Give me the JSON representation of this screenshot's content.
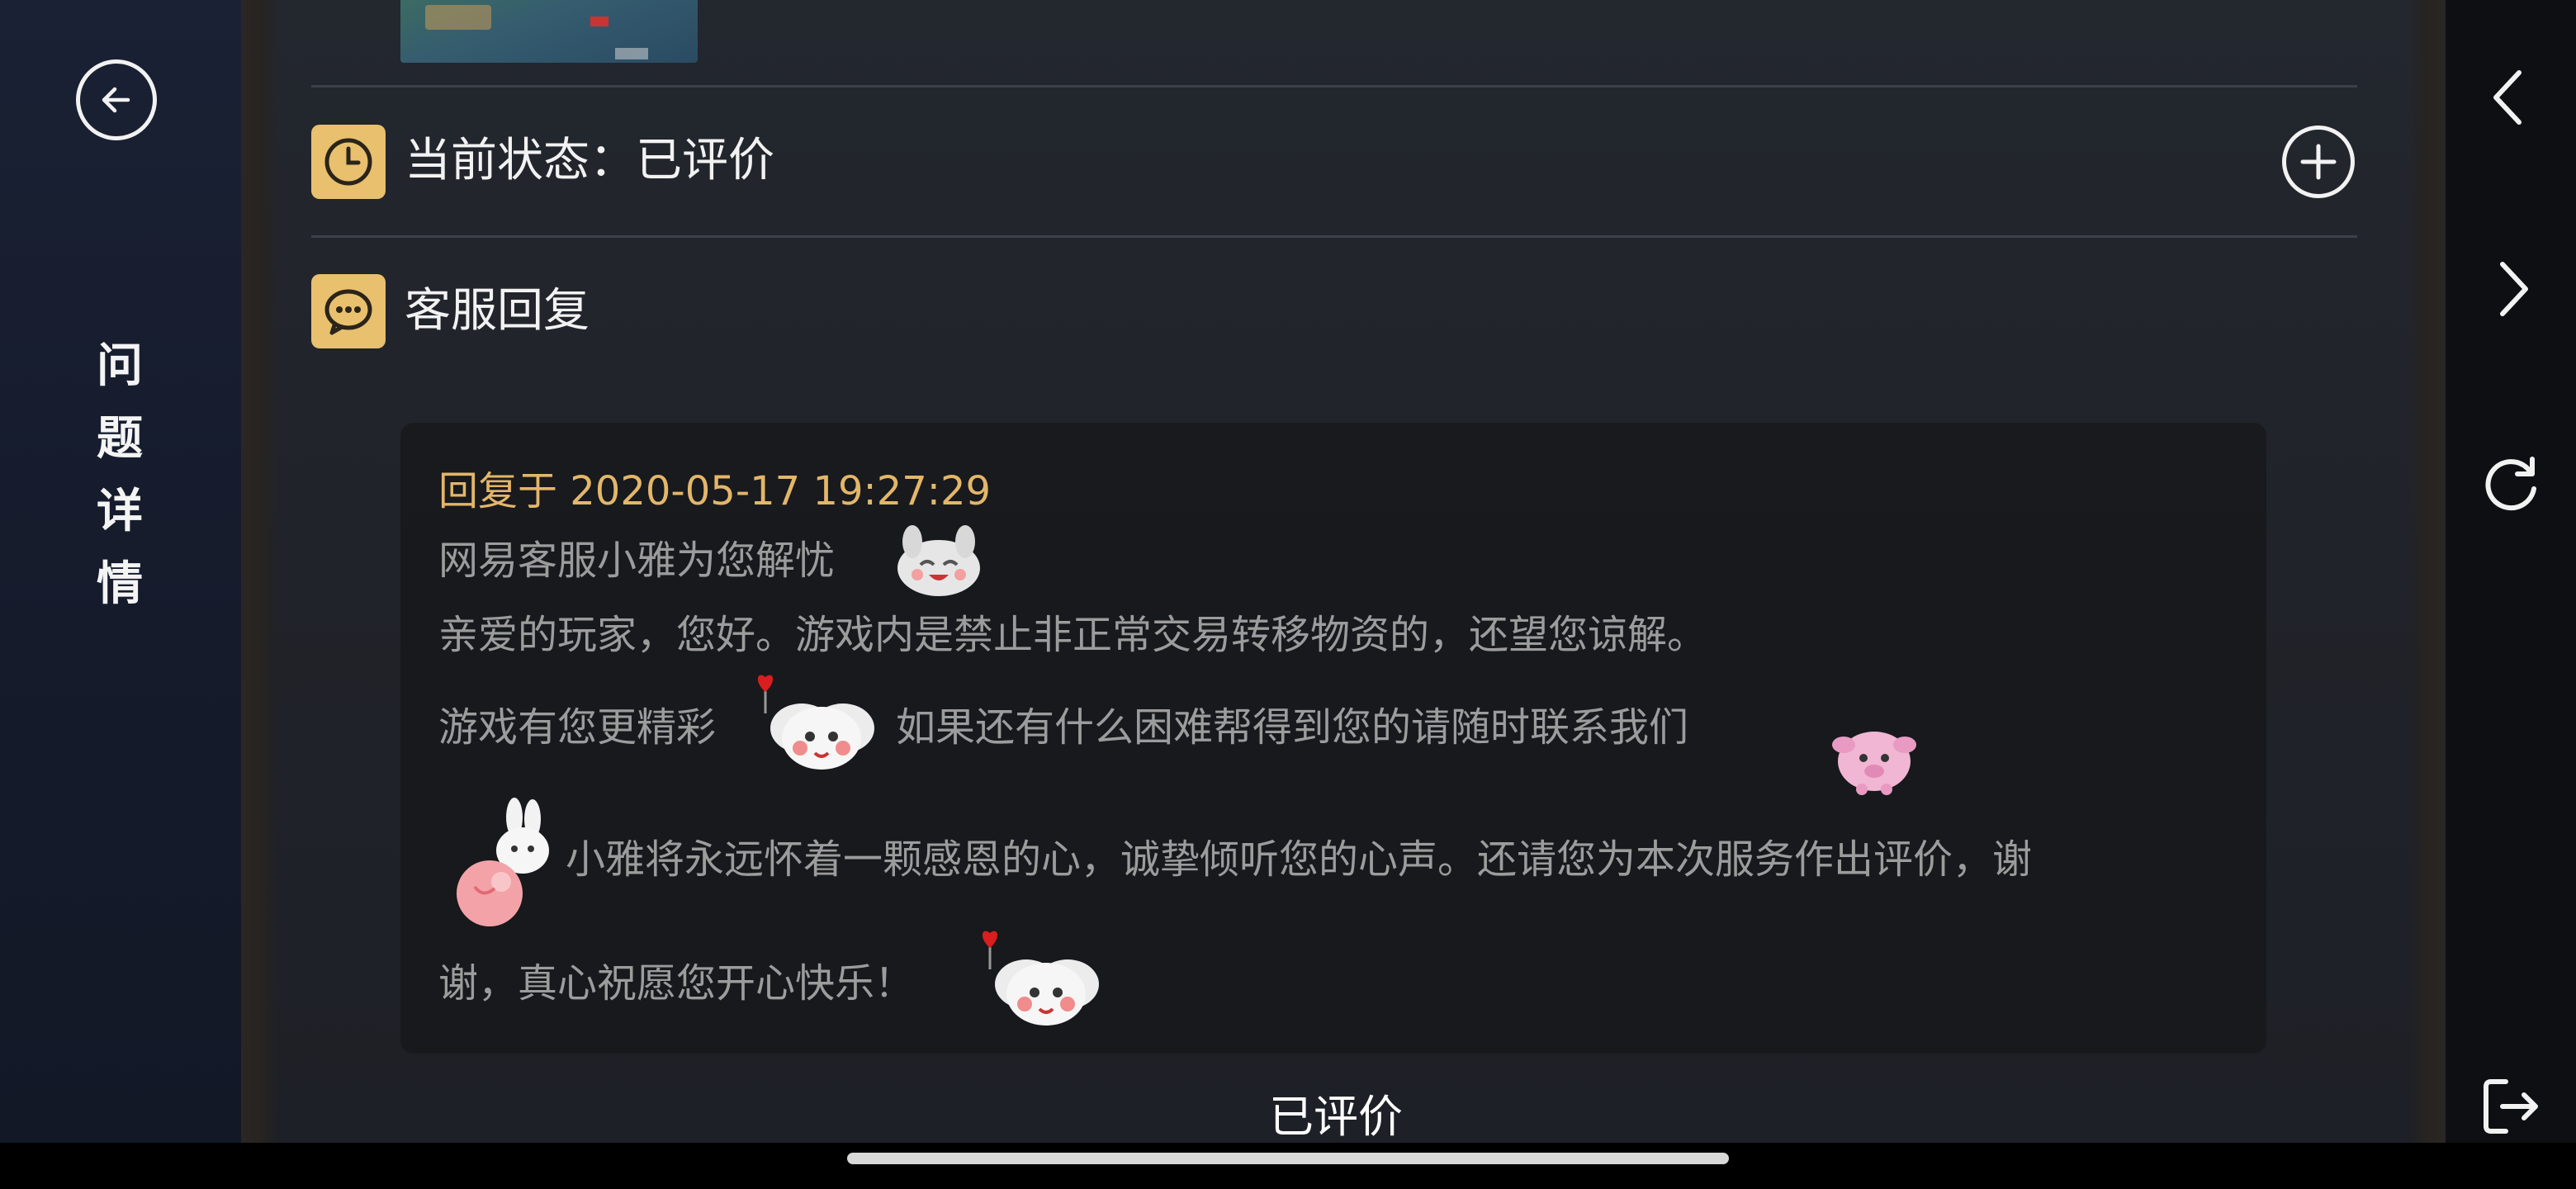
{
  "sidebar": {
    "title_chars": [
      "问",
      "题",
      "详",
      "情"
    ],
    "back_icon": "back-arrow-circle-icon"
  },
  "status_row": {
    "label": "当前状态：已评价",
    "icon": "clock-icon",
    "expand_icon": "plus-circle-icon"
  },
  "reply_section": {
    "label": "客服回复",
    "icon": "chat-bubble-icon",
    "time": "回复于 2020-05-17 19:27:29",
    "lines": [
      "网易客服小雅为您解忧",
      "亲爱的玩家，您好。游戏内是禁止非正常交易转移物资的，还望您谅解。",
      "游戏有您更精彩",
      "如果还有什么困难帮得到您的请随时联系我们",
      "小雅将永远怀着一颗感恩的心，诚挚倾听您的心声。还请您为本次服务作出评价，谢",
      "谢，真心祝愿您开心快乐！"
    ],
    "emotes": [
      "rabbit-laugh-emote",
      "angel-balloon-emote",
      "pink-pig-emote",
      "bunny-hug-emote",
      "angel-balloon-emote"
    ]
  },
  "status_footer": "已评价",
  "nav": {
    "icons": [
      "chevron-left-icon",
      "chevron-right-icon",
      "refresh-icon",
      "exit-icon"
    ]
  },
  "colors": {
    "accent_gold": "#e8c06e",
    "time_gold": "#e3b66a",
    "sidebar_bg": "#1a2134",
    "content_bg": "#202329"
  }
}
